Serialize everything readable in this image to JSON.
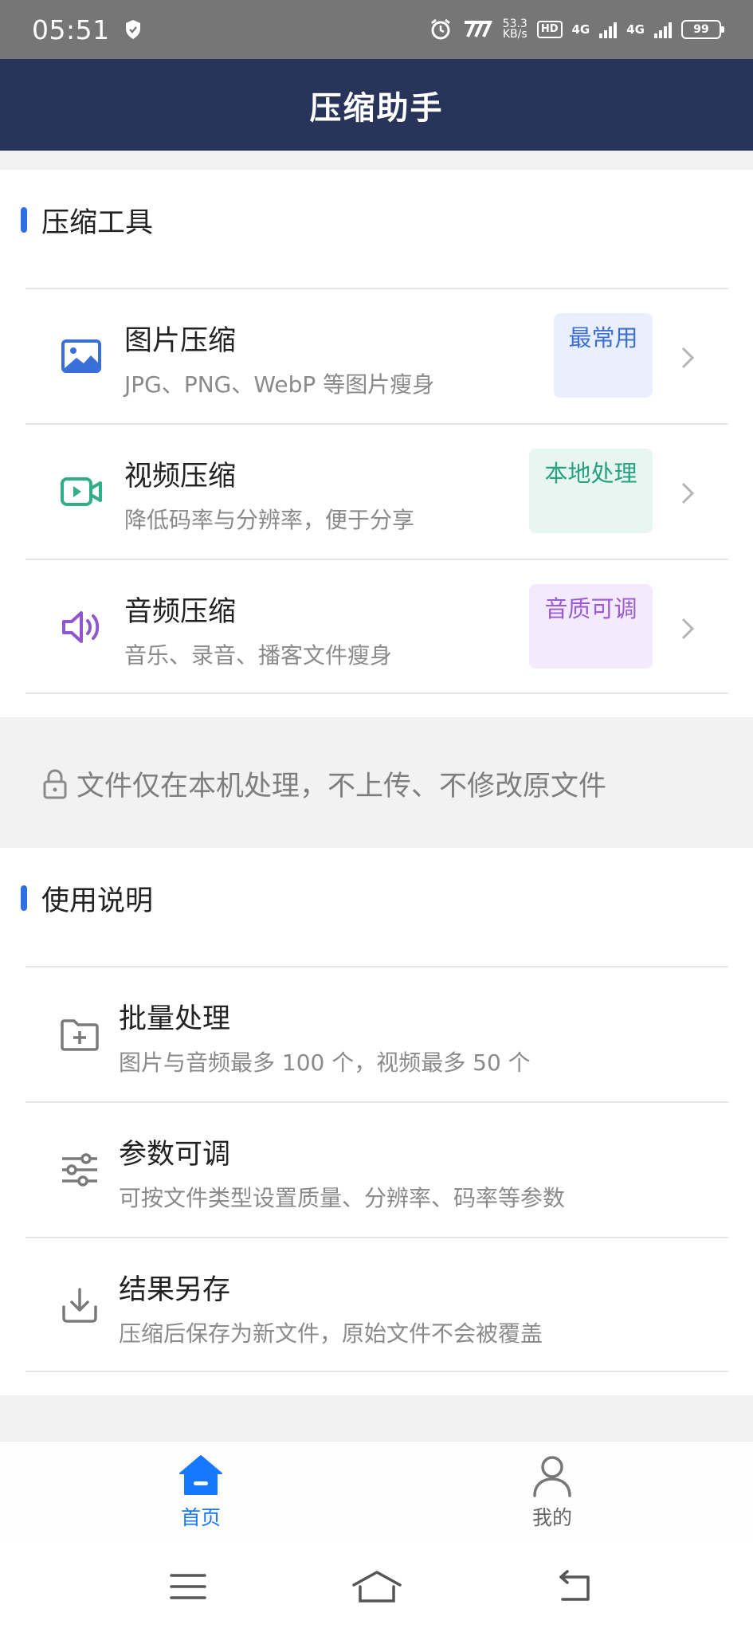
{
  "status_bar": {
    "time": "05:51",
    "speed_value": "53.3",
    "speed_unit": "KB/s",
    "hd_label": "HD",
    "net_1": "4G",
    "net_2": "4G",
    "battery": "99"
  },
  "app": {
    "title": "压缩助手"
  },
  "tools_section": {
    "title": "压缩工具",
    "items": [
      {
        "title": "图片压缩",
        "subtitle": "JPG、PNG、WebP 等图片瘦身",
        "tag": "最常用",
        "icon": "image-icon",
        "tag_bg": "#e9effd",
        "tag_color": "#3d6fd6",
        "icon_color": "#3a6fd8"
      },
      {
        "title": "视频压缩",
        "subtitle": "降低码率与分辨率，便于分享",
        "tag": "本地处理",
        "icon": "video-icon",
        "tag_bg": "#e8f6f1",
        "tag_color": "#2aa17e",
        "icon_color": "#2fae88"
      },
      {
        "title": "音频压缩",
        "subtitle": "音乐、录音、播客文件瘦身",
        "tag": "音质可调",
        "icon": "speaker-icon",
        "tag_bg": "#f3eafd",
        "tag_color": "#9a5bd4",
        "icon_color": "#8f56cf"
      }
    ]
  },
  "privacy_notice": "文件仅在本机处理，不上传、不修改原文件",
  "guide_section": {
    "title": "使用说明",
    "items": [
      {
        "title": "批量处理",
        "subtitle": "图片与音频最多 100 个，视频最多 50 个",
        "icon": "folder-plus-icon"
      },
      {
        "title": "参数可调",
        "subtitle": "可按文件类型设置质量、分辨率、码率等参数",
        "icon": "sliders-icon"
      },
      {
        "title": "结果另存",
        "subtitle": "压缩后保存为新文件，原始文件不会被覆盖",
        "icon": "download-icon"
      }
    ]
  },
  "tabbar": {
    "home_label": "首页",
    "mine_label": "我的",
    "active_color": "#1677ff",
    "inactive_color": "#666666"
  },
  "navbar": {
    "buttons": [
      "menu-icon",
      "home-nav-icon",
      "back-icon"
    ]
  },
  "colors": {
    "appbar": "#283459",
    "accent": "#2f6fe4"
  }
}
